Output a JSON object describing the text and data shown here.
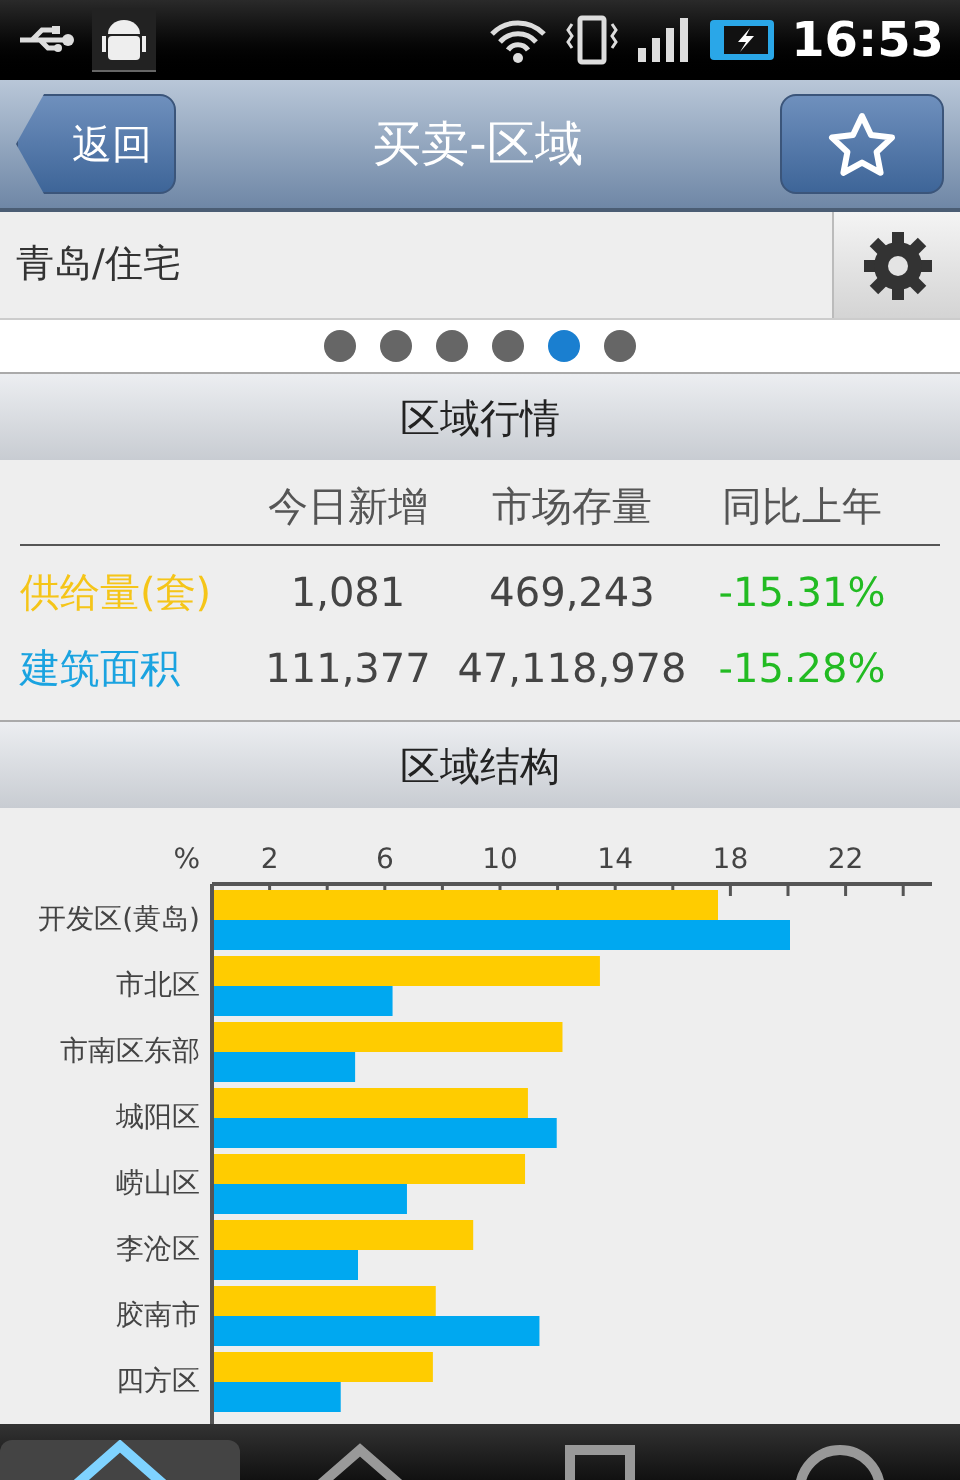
{
  "status_bar": {
    "time": "16:53"
  },
  "header": {
    "back": "返回",
    "title": "买卖-区域"
  },
  "filter": {
    "value": "青岛/住宅"
  },
  "pager": [
    {
      "selected": false
    },
    {
      "selected": false
    },
    {
      "selected": false
    },
    {
      "selected": false
    },
    {
      "selected": true
    },
    {
      "selected": false
    }
  ],
  "market": {
    "title": "区域行情",
    "columns": [
      "今日新增",
      "市场存量",
      "同比上年"
    ],
    "rows": [
      {
        "label": "供给量(套)",
        "color": "#f5c518",
        "cells": [
          "1,081",
          "469,243",
          "-15.31%"
        ]
      },
      {
        "label": "建筑面积",
        "color": "#1aa3e0",
        "cells": [
          "111,377",
          "47,118,978",
          "-15.28%"
        ]
      }
    ]
  },
  "structure": {
    "title": "区域结构",
    "chart_data": {
      "type": "bar",
      "orientation": "horizontal",
      "xlabel": "%",
      "categories": [
        "开发区(黄岛)",
        "市北区",
        "市南区东部",
        "城阳区",
        "崂山区",
        "李沧区",
        "胶南市",
        "四方区"
      ],
      "series": [
        {
          "color": "#ffcc00",
          "values": [
            17.5,
            13.4,
            12.1,
            10.9,
            10.8,
            9.0,
            7.7,
            7.6
          ]
        },
        {
          "color": "#00a8f0",
          "values": [
            20.0,
            6.2,
            4.9,
            11.9,
            6.7,
            5.0,
            11.3,
            4.4
          ]
        }
      ],
      "xlim": [
        0,
        25
      ],
      "xticks": [
        2,
        6,
        10,
        14,
        18,
        22
      ]
    }
  },
  "tabs": [
    {
      "selected": true
    },
    {
      "selected": false
    },
    {
      "selected": false
    },
    {
      "selected": false
    }
  ]
}
